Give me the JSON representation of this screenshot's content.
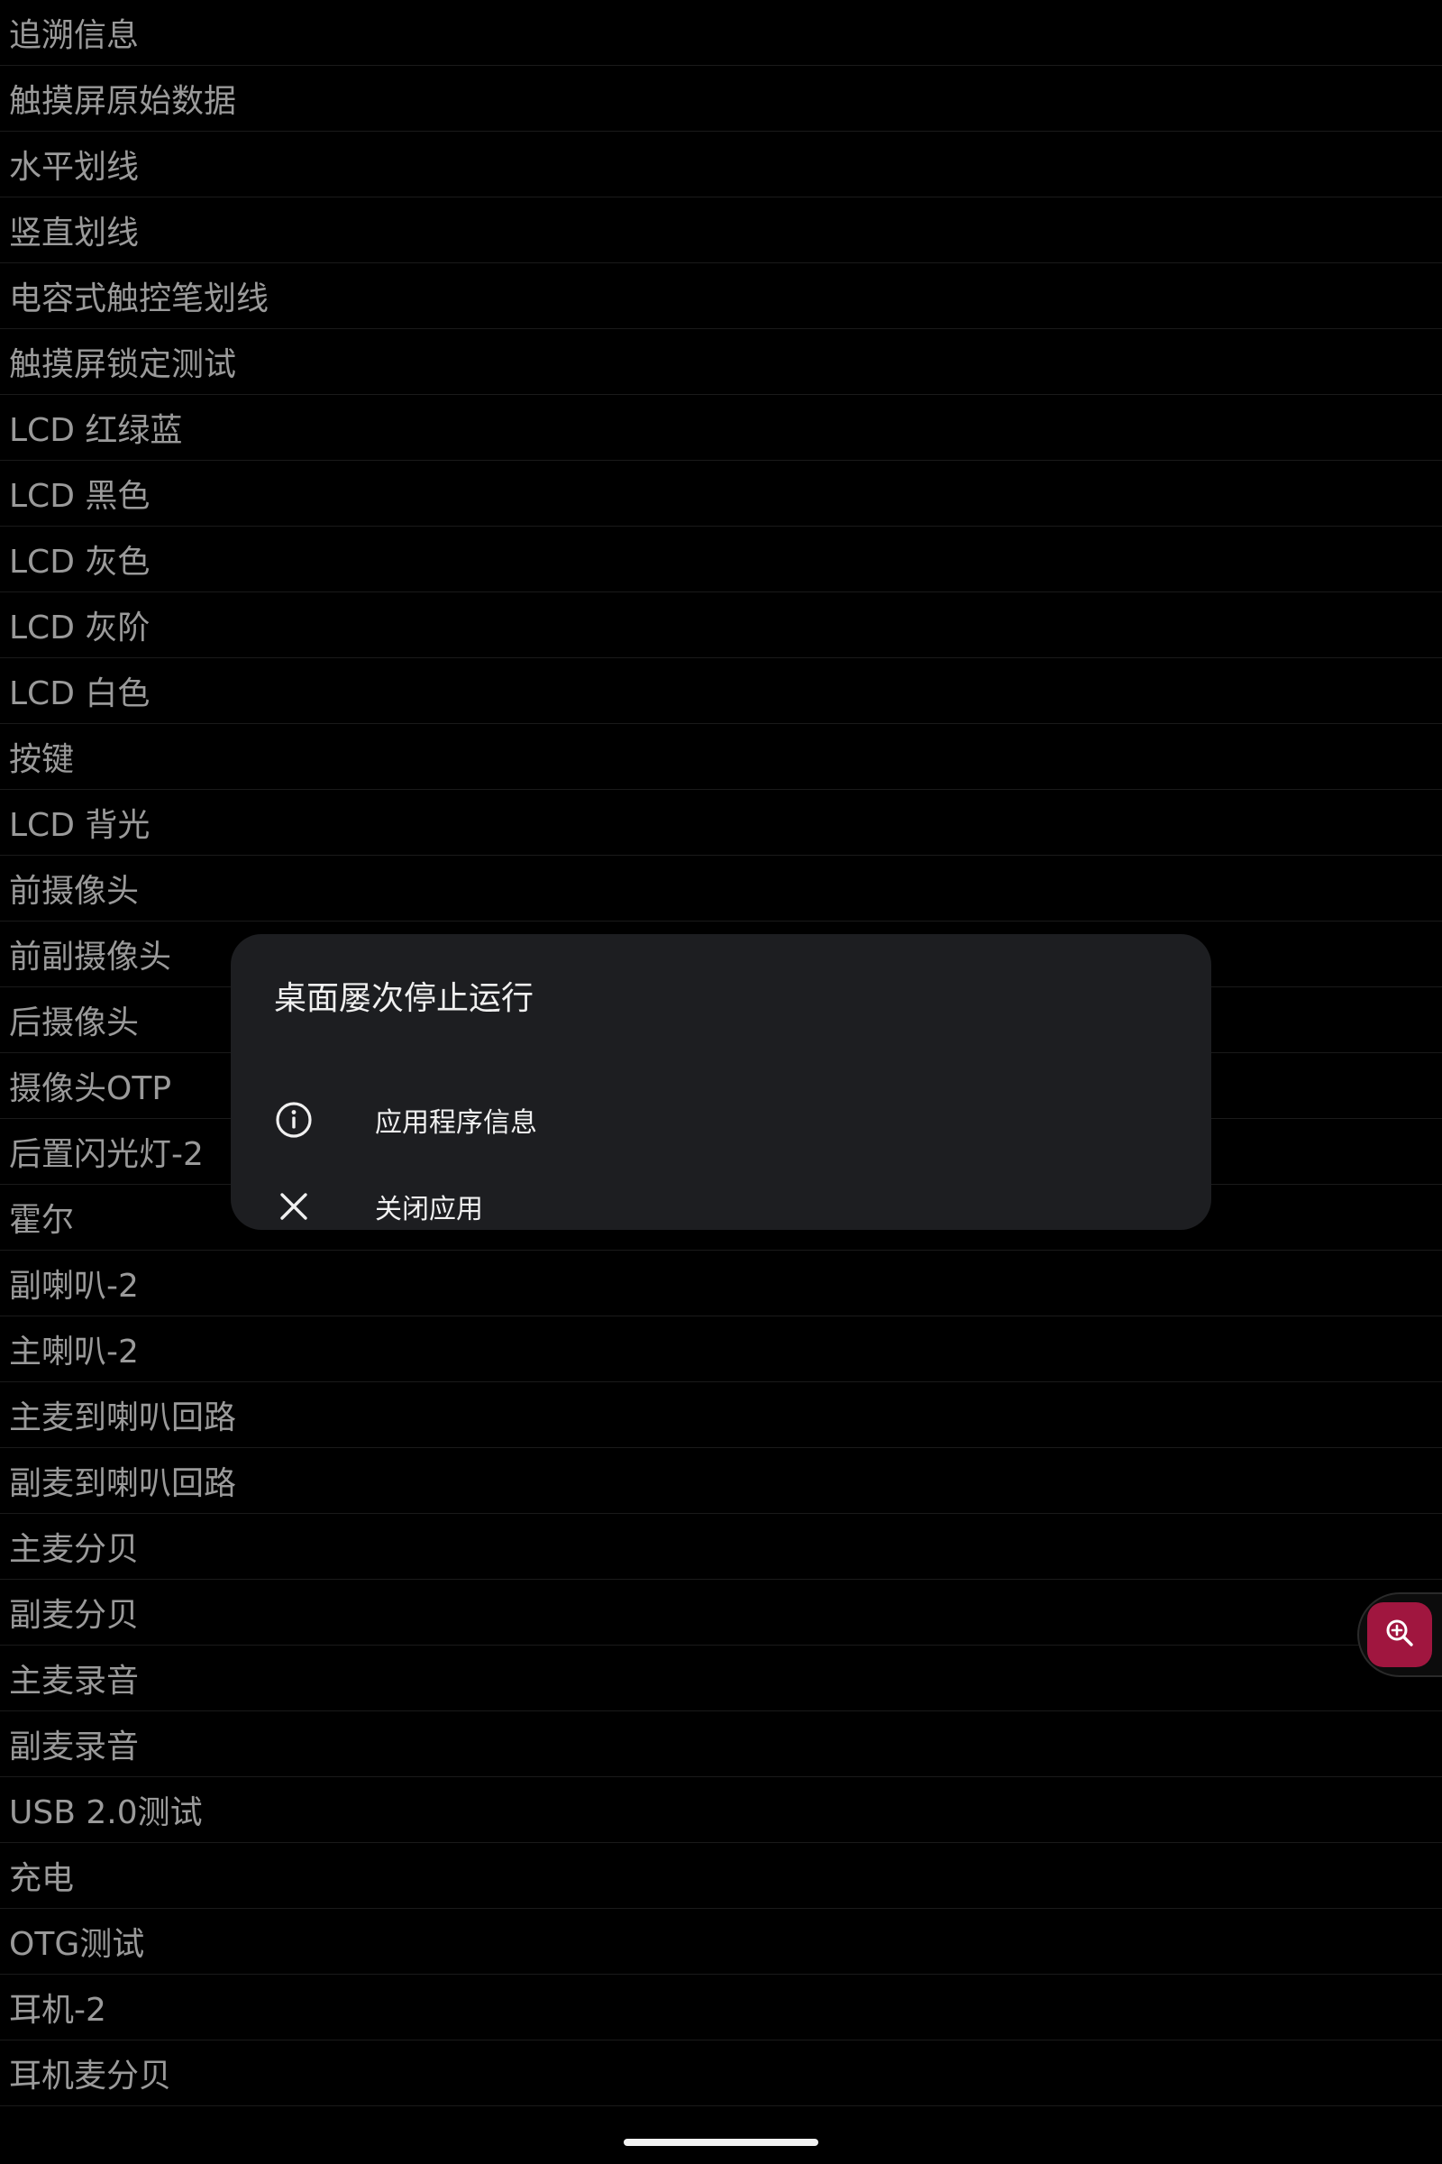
{
  "test_items": [
    "追溯信息",
    "触摸屏原始数据",
    "水平划线",
    "竖直划线",
    "电容式触控笔划线",
    "触摸屏锁定测试",
    "LCD 红绿蓝",
    "LCD 黑色",
    "LCD 灰色",
    "LCD 灰阶",
    "LCD 白色",
    "按键",
    "LCD 背光",
    "前摄像头",
    "前副摄像头",
    "后摄像头",
    "摄像头OTP",
    "后置闪光灯-2",
    "霍尔",
    "副喇叭-2",
    "主喇叭-2",
    "主麦到喇叭回路",
    "副麦到喇叭回路",
    "主麦分贝",
    "副麦分贝",
    "主麦录音",
    "副麦录音",
    "USB 2.0测试",
    "充电",
    "OTG测试",
    "耳机-2",
    "耳机麦分贝"
  ],
  "dialog": {
    "title": "桌面屡次停止运行",
    "app_info_label": "应用程序信息",
    "close_app_label": "关闭应用",
    "app_info_icon": "info-circle-icon",
    "close_app_icon": "close-x-icon"
  },
  "floating": {
    "zoom_icon": "zoom-in-icon",
    "accent_color": "#a0163f"
  }
}
